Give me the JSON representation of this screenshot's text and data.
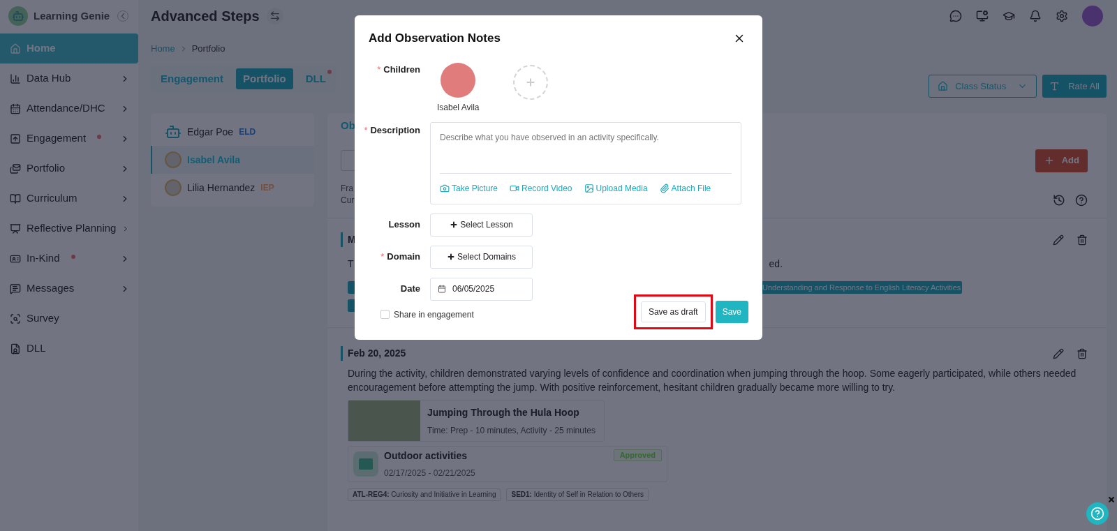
{
  "sidebar": {
    "brand": "Learning Genie",
    "items": [
      {
        "label": "Home",
        "selected": true,
        "chevron": false,
        "dot": false
      },
      {
        "label": "Data Hub",
        "selected": false,
        "chevron": true,
        "dot": false
      },
      {
        "label": "Attendance/DHC",
        "selected": false,
        "chevron": true,
        "dot": false
      },
      {
        "label": "Engagement",
        "selected": false,
        "chevron": true,
        "dot": true
      },
      {
        "label": "Portfolio",
        "selected": false,
        "chevron": true,
        "dot": false
      },
      {
        "label": "Curriculum",
        "selected": false,
        "chevron": true,
        "dot": false
      },
      {
        "label": "Reflective Planning",
        "selected": false,
        "chevron": true,
        "dot": false
      },
      {
        "label": "In-Kind",
        "selected": false,
        "chevron": true,
        "dot": true
      },
      {
        "label": "Messages",
        "selected": false,
        "chevron": true,
        "dot": false
      },
      {
        "label": "Survey",
        "selected": false,
        "chevron": false,
        "dot": false
      },
      {
        "label": "DLL",
        "selected": false,
        "chevron": false,
        "dot": false
      }
    ]
  },
  "header": {
    "title": "Advanced Steps"
  },
  "breadcrumb": [
    "Home",
    "Portfolio"
  ],
  "tabs": [
    {
      "label": "Engagement",
      "selected": false,
      "dot": false
    },
    {
      "label": "Portfolio",
      "selected": true,
      "dot": false
    },
    {
      "label": "DLL",
      "selected": false,
      "dot": true
    }
  ],
  "toolbar": {
    "class_status": "Class Status",
    "rate_all": "Rate All"
  },
  "children": [
    {
      "name": "Edgar Poe",
      "tag": {
        "kind": "eld",
        "label": "ELD"
      },
      "kind": "robot",
      "selected": false
    },
    {
      "name": "Isabel Avila",
      "kind": "photo",
      "selected": true
    },
    {
      "name": "Lilia Hernandez",
      "tag": {
        "kind": "iep",
        "label": "IEP"
      },
      "kind": "photo",
      "selected": false
    }
  ],
  "panel": {
    "tab": "Ob",
    "add": "Add",
    "info_lines": [
      "Fra",
      "Cur"
    ],
    "covered_entry": {
      "date": "M",
      "text_left": "T",
      "text_right": "ed.",
      "tag": "Understanding and Response to English Literacy Activities"
    },
    "entry": {
      "date": "Feb 20, 2025",
      "text": "During the activity, children demonstrated varying levels of confidence and coordination when jumping through the hoop. Some eagerly participated, while others needed encouragement before attempting the jump. With positive reinforcement, hesitant children gradually became more willing to try.",
      "lesson": {
        "title": "Jumping Through the Hula Hoop",
        "time": "Time: Prep - 10 minutes, Activity - 25 minutes"
      },
      "plan": {
        "title": "Outdoor activities",
        "dates": "02/17/2025 - 02/21/2025",
        "status": "Approved"
      },
      "standards": [
        "**ATL-REG4:** Curiosity and Initiative in Learning",
        "**SED1:** Identity of Self in Relation to Others"
      ]
    }
  },
  "modal": {
    "title": "Add Observation Notes",
    "children_field": {
      "label": "Children",
      "required_mark": "*",
      "child": "Isabel Avila"
    },
    "description": {
      "label": "Description",
      "required_mark": "*",
      "placeholder": "Describe what you have observed in an activity specifically.",
      "media": [
        {
          "kind": "camera",
          "label": "Take Picture"
        },
        {
          "kind": "video",
          "label": "Record Video"
        },
        {
          "kind": "image",
          "label": "Upload Media"
        },
        {
          "kind": "attach",
          "label": "Attach File"
        }
      ]
    },
    "lesson": {
      "label": "Lesson",
      "button": "Select Lesson"
    },
    "domain": {
      "label": "Domain",
      "required_mark": "*",
      "button": "Select Domains"
    },
    "date": {
      "label": "Date",
      "value": "06/05/2025"
    },
    "share": {
      "label": "Share in engagement",
      "checked": false
    },
    "draft": {
      "label": "Save as draft",
      "highlighted": true
    },
    "save": "Save"
  }
}
